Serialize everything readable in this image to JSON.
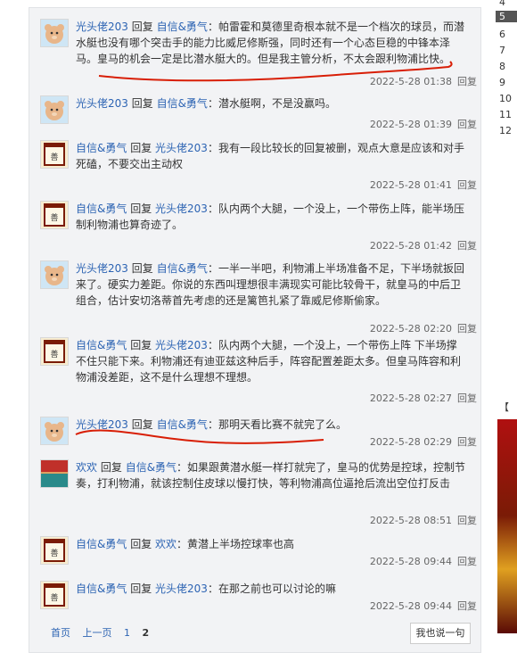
{
  "replies": [
    {
      "author": "光头佬203",
      "verb": "回复",
      "target": "自信&勇气",
      "content": "：帕雷霍和莫德里奇根本就不是一个档次的球员，而潜水艇也没有哪个突击手的能力比威尼修斯强，同时还有一个心态巨稳的中锋本泽马。皇马的机会一定是比潜水艇大的。但是我主管分析，不太会跟利物浦比快。",
      "time": "2022-5-28 01:38",
      "reply_label": "回复",
      "avatar": "bear"
    },
    {
      "author": "光头佬203",
      "verb": "回复",
      "target": "自信&勇气",
      "content": "：潜水艇啊，不是没赢吗。",
      "time": "2022-5-28 01:39",
      "reply_label": "回复",
      "avatar": "bear"
    },
    {
      "author": "自信&勇气",
      "verb": "回复",
      "target": "光头佬203",
      "content": "：我有一段比较长的回复被删，观点大意是应该和对手死磕，不要交出主动权",
      "time": "2022-5-28 01:41",
      "reply_label": "回复",
      "avatar": "scroll"
    },
    {
      "author": "自信&勇气",
      "verb": "回复",
      "target": "光头佬203",
      "content": "：队内两个大腿，一个没上，一个带伤上阵，能半场压制利物浦也算奇迹了。",
      "time": "2022-5-28 01:42",
      "reply_label": "回复",
      "avatar": "scroll"
    },
    {
      "author": "光头佬203",
      "verb": "回复",
      "target": "自信&勇气",
      "content": "：一半一半吧，利物浦上半场准备不足，下半场就扳回来了。硬实力差距。你说的东西叫理想很丰满现实可能比较骨干，就皇马的中后卫组合，估计安切洛蒂首先考虑的还是篱笆扎紧了靠威尼修斯偷家。",
      "time": "2022-5-28 02:20",
      "reply_label": "回复",
      "avatar": "bear"
    },
    {
      "author": "自信&勇气",
      "verb": "回复",
      "target": "光头佬203",
      "content": "：队内两个大腿，一个没上，一个带伤上阵 下半场撑不住只能下来。利物浦还有迪亚兹这种后手，阵容配置差距太多。但皇马阵容和利物浦没差距，这不是什么理想不理想。",
      "time": "2022-5-28 02:27",
      "reply_label": "回复",
      "avatar": "scroll"
    },
    {
      "author": "光头佬203",
      "verb": "回复",
      "target": "自信&勇气",
      "content": "：那明天看比赛不就完了么。",
      "time": "2022-5-28 02:29",
      "reply_label": "回复",
      "avatar": "bear"
    },
    {
      "author": "欢欢",
      "verb": "回复",
      "target": "自信&勇气",
      "content": "：如果跟黄潜水艇一样打就完了，皇马的优势是控球，控制节奏，打利物浦，就该控制住皮球以慢打快，等利物浦高位逼抢后流出空位打反击",
      "time": "2022-5-28 08:51",
      "reply_label": "回复",
      "avatar": "sunset"
    },
    {
      "author": "自信&勇气",
      "verb": "回复",
      "target": "欢欢",
      "content": "：黄潜上半场控球率也高",
      "time": "2022-5-28 09:44",
      "reply_label": "回复",
      "avatar": "scroll"
    },
    {
      "author": "自信&勇气",
      "verb": "回复",
      "target": "光头佬203",
      "content": "：在那之前也可以讨论的嘛",
      "time": "2022-5-28 09:44",
      "reply_label": "回复",
      "avatar": "scroll"
    }
  ],
  "pager": {
    "first": "首页",
    "prev": "上一页",
    "pages": [
      "1",
      "2"
    ],
    "current": "2"
  },
  "say_button": "我也说一句",
  "sidebar": {
    "items": [
      "4",
      "5",
      "6",
      "7",
      "8",
      "9",
      "10",
      "11",
      "12"
    ],
    "item_tails": [
      "",
      "",
      "",
      "",
      "",
      "",
      "",
      "",
      ""
    ],
    "active_index": 1,
    "hint": "【"
  },
  "colors": {
    "link": "#2d64b3",
    "panel": "#f2f3f5",
    "annotation": "#d81e06"
  }
}
